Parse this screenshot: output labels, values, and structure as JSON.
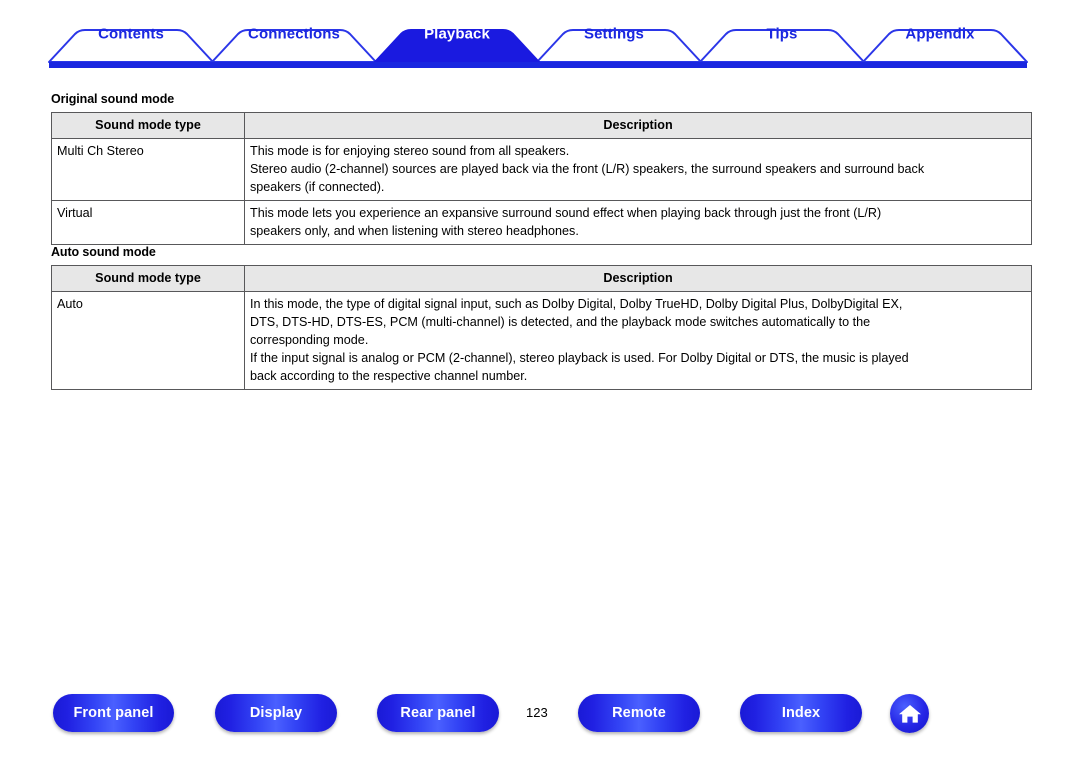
{
  "tabs": [
    {
      "label": "Contents",
      "active": false
    },
    {
      "label": "Connections",
      "active": false
    },
    {
      "label": "Playback",
      "active": true
    },
    {
      "label": "Settings",
      "active": false
    },
    {
      "label": "Tips",
      "active": false
    },
    {
      "label": "Appendix",
      "active": false
    }
  ],
  "sections": [
    {
      "title": "Original sound mode",
      "headers": {
        "type": "Sound mode type",
        "description": "Description"
      },
      "rows": [
        {
          "type": "Multi Ch Stereo",
          "description_lines": [
            "This mode is for enjoying stereo sound from all speakers.",
            "Stereo audio (2-channel) sources are played back via the front (L/R) speakers, the surround speakers and surround back",
            "speakers (if connected)."
          ]
        },
        {
          "type": "Virtual",
          "description_lines": [
            "This mode lets you experience an expansive surround sound effect when playing back through just the front (L/R)",
            "speakers only, and when listening with stereo headphones."
          ]
        }
      ]
    },
    {
      "title": "Auto sound mode",
      "headers": {
        "type": "Sound mode type",
        "description": "Description"
      },
      "rows": [
        {
          "type": "Auto",
          "description_lines": [
            "In this mode, the type of digital signal input, such as Dolby Digital, Dolby TrueHD, Dolby Digital Plus, DolbyDigital EX,",
            "DTS, DTS-HD, DTS-ES, PCM (multi-channel) is detected, and the playback mode switches automatically to the",
            "corresponding mode.",
            "If the input signal is analog or PCM (2-channel), stereo playback is used. For Dolby Digital or DTS, the music is played",
            "back according to the respective channel number."
          ]
        }
      ]
    }
  ],
  "footer": {
    "buttons": [
      {
        "label": "Front panel"
      },
      {
        "label": "Display"
      },
      {
        "label": "Rear panel"
      },
      {
        "label": "Remote"
      },
      {
        "label": "Index"
      }
    ],
    "page_number": "123",
    "home_icon": "home-icon"
  },
  "colors": {
    "brand_blue": "#1a27e0",
    "active_tab": "#1a1ae0",
    "header_gray": "#e7e7e7",
    "border_gray": "#58585a"
  }
}
